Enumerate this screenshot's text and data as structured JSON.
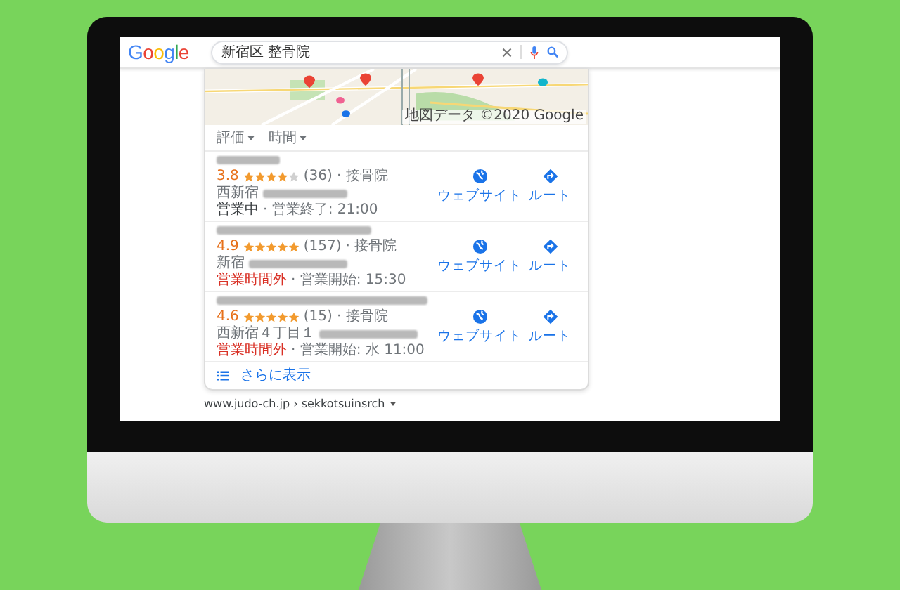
{
  "browser": {
    "logo": "Google",
    "query": "新宿区 整骨院"
  },
  "map": {
    "attribution": "地図データ ©2020 Google"
  },
  "filters": [
    {
      "label": "評価"
    },
    {
      "label": "時間"
    }
  ],
  "places": [
    {
      "rating": "3.8",
      "stars": 4,
      "reviews": "(36)",
      "category": "· 接骨院",
      "address": "西新宿",
      "open": true,
      "status": "営業中",
      "hours": "· 営業終了: 21:00",
      "actions": [
        "ウェブサイト",
        "ルート"
      ]
    },
    {
      "rating": "4.9",
      "stars": 5,
      "reviews": "(157)",
      "category": "· 接骨院",
      "address": "新宿",
      "open": false,
      "status": "営業時間外",
      "hours": "· 営業開始: 15:30",
      "actions": [
        "ウェブサイト",
        "ルート"
      ]
    },
    {
      "rating": "4.6",
      "stars": 5,
      "reviews": "(15)",
      "category": "· 接骨院",
      "address": "西新宿４丁目１",
      "open": false,
      "status": "営業時間外",
      "hours": "· 営業開始: 水 11:00",
      "actions": [
        "ウェブサイト",
        "ルート"
      ]
    }
  ],
  "more": "さらに表示",
  "result": {
    "url": "www.judo-ch.jp › sekkotsuinsrch"
  }
}
